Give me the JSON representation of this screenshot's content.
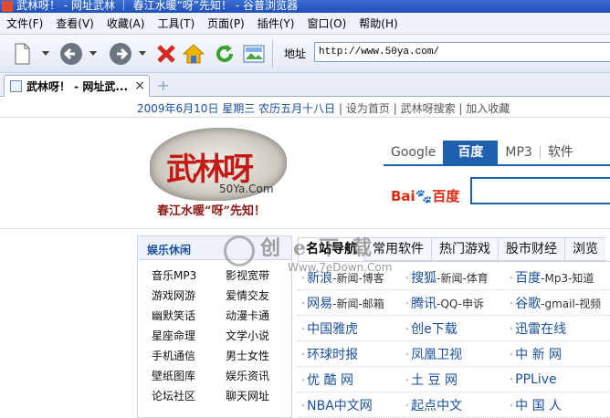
{
  "window": {
    "title": "武林呀！ - 网址武林 ｜ 春江水暖“呀”先知！ - 谷普浏览器"
  },
  "menubar": [
    "文件(F)",
    "查看(V)",
    "收藏(A)",
    "工具(T)",
    "页面(P)",
    "插件(Y)",
    "窗口(O)",
    "帮助(H)"
  ],
  "toolbar": {
    "address_label": "地址",
    "address_value": "http://www.50ya.com/"
  },
  "tab": {
    "label": "武林呀！ - 网址武...",
    "close": "×",
    "new_tab": "+"
  },
  "page": {
    "datebar": {
      "date": "2009年6月10日",
      "weekday": "星期三",
      "lunar": "农历五月十八日",
      "sep": "|",
      "links": [
        "设为首页",
        "武林呀搜索",
        "加入收藏"
      ]
    },
    "logo": {
      "brand": "武林呀",
      "domain": "50Ya.Com",
      "slogan": "春江水暖“呀”先知！"
    },
    "search_tabs": [
      "Google",
      "百度",
      "MP3",
      "软件"
    ],
    "search_active_index": 1,
    "baidu_logo": {
      "bai": "Bai",
      "du": "百度"
    },
    "left_box": {
      "title": "娱乐休闲",
      "items": [
        "音乐MP3",
        "影视宽带",
        "游戏网游",
        "爱情交友",
        "幽默笑话",
        "动漫卡通",
        "星座命理",
        "文学小说",
        "手机通信",
        "男士女性",
        "壁纸图库",
        "娱乐资讯",
        "论坛社区",
        "聊天网址"
      ]
    },
    "nav_tabs": [
      "名站导航",
      "常用软件",
      "热门游戏",
      "股市财经",
      "浏览"
    ],
    "nav_active_index": 0,
    "sites": [
      [
        {
          "main": "新浪",
          "sub": "-新闻-博客"
        },
        {
          "main": "搜狐",
          "sub": "-新闻-体育"
        },
        {
          "main": "百度",
          "sub": "-Mp3-知道"
        }
      ],
      [
        {
          "main": "网易",
          "sub": "-新闻-邮箱"
        },
        {
          "main": "腾讯",
          "sub": "-QQ-申诉"
        },
        {
          "main": "谷歌",
          "sub": "-gmail-视频"
        }
      ],
      [
        {
          "main": "中国雅虎",
          "sub": ""
        },
        {
          "main": "创e下载",
          "sub": ""
        },
        {
          "main": "迅雷在线",
          "sub": ""
        }
      ],
      [
        {
          "main": "环球时报",
          "sub": ""
        },
        {
          "main": "凤凰卫视",
          "sub": ""
        },
        {
          "main": "中 新 网",
          "sub": ""
        }
      ],
      [
        {
          "main": "优 酷 网",
          "sub": ""
        },
        {
          "main": "土 豆 网",
          "sub": ""
        },
        {
          "main": "PPLive",
          "sub": ""
        }
      ],
      [
        {
          "main": "NBA中文网",
          "sub": ""
        },
        {
          "main": "起点中文",
          "sub": ""
        },
        {
          "main": "中 国 人",
          "sub": ""
        }
      ]
    ],
    "watermark": {
      "text": "创e下载",
      "url": "Www.7eDown.Com"
    }
  }
}
